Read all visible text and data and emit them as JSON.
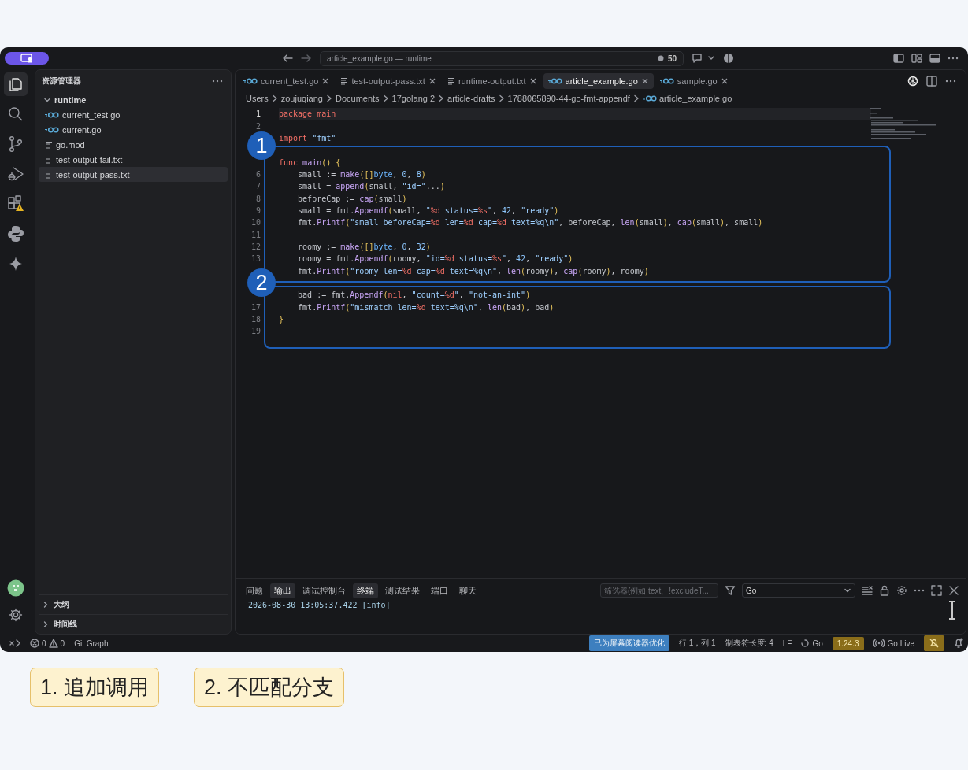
{
  "title_bar": {
    "search": "article_example.go — runtime",
    "count": "50"
  },
  "sidebar": {
    "title": "资源管理器",
    "folder": {
      "name": "runtime",
      "expanded": true,
      "children": [
        {
          "name": "current_test.go",
          "kind": "go",
          "selected": false
        },
        {
          "name": "current.go",
          "kind": "go",
          "selected": false
        },
        {
          "name": "go.mod",
          "kind": "text",
          "selected": false
        },
        {
          "name": "test-output-fail.txt",
          "kind": "text",
          "selected": false
        },
        {
          "name": "test-output-pass.txt",
          "kind": "text",
          "selected": true
        }
      ]
    },
    "sections": [
      {
        "name": "大纲",
        "expanded": false
      },
      {
        "name": "时间线",
        "expanded": false
      }
    ]
  },
  "tabs": [
    {
      "label": "current_test.go",
      "kind": "go",
      "selected": false
    },
    {
      "label": "test-output-pass.txt",
      "kind": "text",
      "selected": false
    },
    {
      "label": "runtime-output.txt",
      "kind": "text",
      "selected": false
    },
    {
      "label": "article_example.go",
      "kind": "go",
      "selected": true
    },
    {
      "label": "sample.go",
      "kind": "go",
      "selected": false
    }
  ],
  "breadcrumb": [
    {
      "label": "Users"
    },
    {
      "label": "zoujuqiang"
    },
    {
      "label": "Documents"
    },
    {
      "label": "17golang 2"
    },
    {
      "label": "article-drafts"
    },
    {
      "label": "1788065890-44-go-fmt-appendf"
    },
    {
      "label": "article_example.go",
      "kind": "go"
    }
  ],
  "editor": {
    "lines": [
      {
        "number": "1",
        "current": true,
        "tokens": [
          {
            "kind": "keyword",
            "text": "package"
          },
          {
            "kind": "keyword",
            "text": " main"
          }
        ]
      },
      {
        "number": "2"
      },
      {
        "tokens": [
          {
            "kind": "keyword",
            "text": "import"
          },
          {
            "kind": "string",
            "text": " \"fmt\""
          }
        ]
      }
    ],
    "blocks": [
      {
        "label": "1",
        "lines": [
          {
            "tokens": [
              {
                "kind": "keyword",
                "text": "func"
              },
              {
                "kind": "function",
                "text": " main"
              },
              {
                "kind": "bracket",
                "text": "() {"
              }
            ]
          },
          {
            "number": "6",
            "tokens": [
              {
                "kind": "plain",
                "text": "    small := "
              },
              {
                "kind": "function",
                "text": "make"
              },
              {
                "kind": "bracket",
                "text": "([]"
              },
              {
                "kind": "type",
                "text": "byte"
              },
              {
                "kind": "plain",
                "text": ", "
              },
              {
                "kind": "number",
                "text": "0"
              },
              {
                "kind": "plain",
                "text": ", "
              },
              {
                "kind": "number",
                "text": "8"
              },
              {
                "kind": "bracket",
                "text": ")"
              }
            ]
          },
          {
            "number": "7",
            "tokens": [
              {
                "kind": "plain",
                "text": "    small = "
              },
              {
                "kind": "function",
                "text": "append"
              },
              {
                "kind": "bracket",
                "text": "("
              },
              {
                "kind": "plain",
                "text": "small, "
              },
              {
                "kind": "string",
                "text": "\"id=\""
              },
              {
                "kind": "plain",
                "text": "..."
              },
              {
                "kind": "bracket",
                "text": ")"
              }
            ]
          },
          {
            "number": "8",
            "tokens": [
              {
                "kind": "plain",
                "text": "    beforeCap := "
              },
              {
                "kind": "function",
                "text": "cap"
              },
              {
                "kind": "bracket",
                "text": "("
              },
              {
                "kind": "plain",
                "text": "small"
              },
              {
                "kind": "bracket",
                "text": ")"
              }
            ]
          },
          {
            "number": "9",
            "tokens": [
              {
                "kind": "plain",
                "text": "    small = fmt."
              },
              {
                "kind": "function",
                "text": "Appendf"
              },
              {
                "kind": "bracket",
                "text": "("
              },
              {
                "kind": "plain",
                "text": "small, "
              },
              {
                "kind": "string",
                "text": "\""
              },
              {
                "kind": "verb",
                "text": "%d"
              },
              {
                "kind": "string",
                "text": " status="
              },
              {
                "kind": "verb",
                "text": "%s"
              },
              {
                "kind": "string",
                "text": "\""
              },
              {
                "kind": "plain",
                "text": ", "
              },
              {
                "kind": "number",
                "text": "42"
              },
              {
                "kind": "plain",
                "text": ", "
              },
              {
                "kind": "string",
                "text": "\"ready\""
              },
              {
                "kind": "bracket",
                "text": ")"
              }
            ]
          },
          {
            "number": "10",
            "tokens": [
              {
                "kind": "plain",
                "text": "    fmt."
              },
              {
                "kind": "function",
                "text": "Printf"
              },
              {
                "kind": "bracket",
                "text": "("
              },
              {
                "kind": "string",
                "text": "\"small beforeCap="
              },
              {
                "kind": "verb",
                "text": "%d"
              },
              {
                "kind": "string",
                "text": " len="
              },
              {
                "kind": "verb",
                "text": "%d"
              },
              {
                "kind": "string",
                "text": " cap="
              },
              {
                "kind": "verb",
                "text": "%d"
              },
              {
                "kind": "string",
                "text": " text=%q\\n\""
              },
              {
                "kind": "plain",
                "text": ", beforeCap, "
              },
              {
                "kind": "function",
                "text": "len"
              },
              {
                "kind": "bracket",
                "text": "("
              },
              {
                "kind": "plain",
                "text": "small"
              },
              {
                "kind": "bracket",
                "text": ")"
              },
              {
                "kind": "plain",
                "text": ", "
              },
              {
                "kind": "function",
                "text": "cap"
              },
              {
                "kind": "bracket",
                "text": "("
              },
              {
                "kind": "plain",
                "text": "small"
              },
              {
                "kind": "bracket",
                "text": ")"
              },
              {
                "kind": "plain",
                "text": ", small"
              },
              {
                "kind": "bracket",
                "text": ")"
              }
            ]
          },
          {
            "number": "11"
          },
          {
            "number": "12",
            "tokens": [
              {
                "kind": "plain",
                "text": "    roomy := "
              },
              {
                "kind": "function",
                "text": "make"
              },
              {
                "kind": "bracket",
                "text": "([]"
              },
              {
                "kind": "type",
                "text": "byte"
              },
              {
                "kind": "plain",
                "text": ", "
              },
              {
                "kind": "number",
                "text": "0"
              },
              {
                "kind": "plain",
                "text": ", "
              },
              {
                "kind": "number",
                "text": "32"
              },
              {
                "kind": "bracket",
                "text": ")"
              }
            ]
          },
          {
            "number": "13",
            "tokens": [
              {
                "kind": "plain",
                "text": "    roomy = fmt."
              },
              {
                "kind": "function",
                "text": "Appendf"
              },
              {
                "kind": "bracket",
                "text": "("
              },
              {
                "kind": "plain",
                "text": "roomy, "
              },
              {
                "kind": "string",
                "text": "\"id="
              },
              {
                "kind": "verb",
                "text": "%d"
              },
              {
                "kind": "string",
                "text": " status="
              },
              {
                "kind": "verb",
                "text": "%s"
              },
              {
                "kind": "string",
                "text": "\""
              },
              {
                "kind": "plain",
                "text": ", "
              },
              {
                "kind": "number",
                "text": "42"
              },
              {
                "kind": "plain",
                "text": ", "
              },
              {
                "kind": "string",
                "text": "\"ready\""
              },
              {
                "kind": "bracket",
                "text": ")"
              }
            ]
          },
          {
            "tokens": [
              {
                "kind": "plain",
                "text": "    fmt."
              },
              {
                "kind": "function",
                "text": "Printf"
              },
              {
                "kind": "bracket",
                "text": "("
              },
              {
                "kind": "string",
                "text": "\"roomy len="
              },
              {
                "kind": "verb",
                "text": "%d"
              },
              {
                "kind": "string",
                "text": " cap="
              },
              {
                "kind": "verb",
                "text": "%d"
              },
              {
                "kind": "string",
                "text": " text=%q\\n\""
              },
              {
                "kind": "plain",
                "text": ", "
              },
              {
                "kind": "function",
                "text": "len"
              },
              {
                "kind": "bracket",
                "text": "("
              },
              {
                "kind": "plain",
                "text": "roomy"
              },
              {
                "kind": "bracket",
                "text": ")"
              },
              {
                "kind": "plain",
                "text": ", "
              },
              {
                "kind": "function",
                "text": "cap"
              },
              {
                "kind": "bracket",
                "text": "("
              },
              {
                "kind": "plain",
                "text": "roomy"
              },
              {
                "kind": "bracket",
                "text": ")"
              },
              {
                "kind": "plain",
                "text": ", roomy"
              },
              {
                "kind": "bracket",
                "text": ")"
              }
            ]
          }
        ]
      },
      {
        "label": "2",
        "lines": [
          {
            "tokens": [
              {
                "kind": "plain",
                "text": "    bad := fmt."
              },
              {
                "kind": "function",
                "text": "Appendf"
              },
              {
                "kind": "bracket",
                "text": "("
              },
              {
                "kind": "keyword",
                "text": "nil"
              },
              {
                "kind": "plain",
                "text": ", "
              },
              {
                "kind": "string",
                "text": "\"count="
              },
              {
                "kind": "verb",
                "text": "%d"
              },
              {
                "kind": "string",
                "text": "\""
              },
              {
                "kind": "plain",
                "text": ", "
              },
              {
                "kind": "string",
                "text": "\"not-an-int\""
              },
              {
                "kind": "bracket",
                "text": ")"
              }
            ]
          },
          {
            "number": "17",
            "tokens": [
              {
                "kind": "plain",
                "text": "    fmt."
              },
              {
                "kind": "function",
                "text": "Printf"
              },
              {
                "kind": "bracket",
                "text": "("
              },
              {
                "kind": "string",
                "text": "\"mismatch len="
              },
              {
                "kind": "verb",
                "text": "%d"
              },
              {
                "kind": "string",
                "text": " text=%q\\n\""
              },
              {
                "kind": "plain",
                "text": ", "
              },
              {
                "kind": "function",
                "text": "len"
              },
              {
                "kind": "bracket",
                "text": "("
              },
              {
                "kind": "plain",
                "text": "bad"
              },
              {
                "kind": "bracket",
                "text": ")"
              },
              {
                "kind": "plain",
                "text": ", bad"
              },
              {
                "kind": "bracket",
                "text": ")"
              }
            ]
          },
          {
            "number": "18",
            "tokens": [
              {
                "kind": "bracket",
                "text": "}"
              }
            ]
          },
          {
            "number": "19"
          }
        ]
      }
    ]
  },
  "panel": {
    "tabs": [
      {
        "label": "问题",
        "selected": false
      },
      {
        "label": "输出",
        "selected": true
      },
      {
        "label": "调试控制台",
        "selected": false
      },
      {
        "label": "终端",
        "selected": true
      },
      {
        "label": "测试结果",
        "selected": false
      },
      {
        "label": "端口",
        "selected": false
      },
      {
        "label": "聊天",
        "selected": false
      }
    ],
    "filter": {
      "placeholder": "筛选器(例如 text、!excludeT..."
    },
    "channel": "Go",
    "output": "2026-08-30 13:05:37.422 [info]"
  },
  "status_bar": {
    "errors": "0",
    "warnings": "0",
    "left": [
      {
        "label": "Git Graph"
      }
    ],
    "right": [
      {
        "label": "已为屏幕阅读器优化",
        "kind": "accent"
      },
      {
        "label": "行 1，列 1",
        "kind": "plain"
      },
      {
        "label": "制表符长度: 4",
        "kind": "plain"
      },
      {
        "label": "LF",
        "kind": "plain"
      },
      {
        "label": "Go",
        "kind": "spinner"
      },
      {
        "label": "1.24.3",
        "kind": "warn"
      },
      {
        "label": "Go Live",
        "kind": "broadcast"
      }
    ]
  },
  "legend": [
    "1. 追加调用",
    "2. 不匹配分支"
  ]
}
